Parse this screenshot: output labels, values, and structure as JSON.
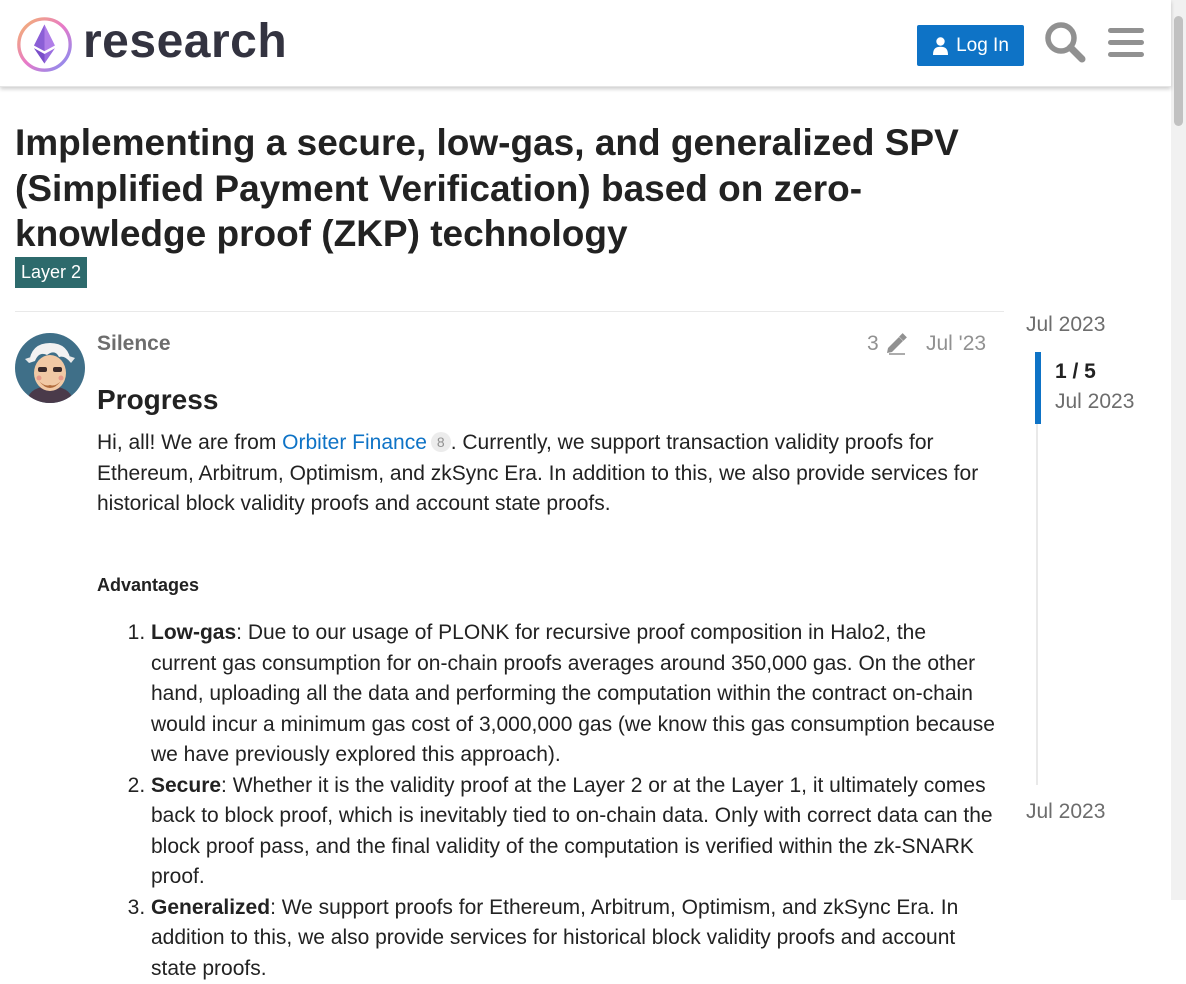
{
  "header": {
    "logo_text": "research",
    "login_label": "Log In",
    "search_icon": "search-icon",
    "menu_icon": "hamburger-menu-icon"
  },
  "topic": {
    "title": "Implementing a secure, low-gas, and generalized SPV (Simplified Payment Verification) based on zero-knowledge proof (ZKP) technology",
    "category": "Layer 2",
    "category_color": "#2d6a6c"
  },
  "post": {
    "username": "Silence",
    "edit_count": "3",
    "date": "Jul '23",
    "heading": "Progress",
    "intro_before": "Hi, all! We are from ",
    "intro_link": "Orbiter Finance",
    "intro_link_clicks": "8",
    "intro_after": ". Currently, we support transaction validity proofs for Ethereum, Arbitrum, Optimism, and zkSync Era. In addition to this, we also provide services for historical block validity proofs and account state proofs.",
    "advantages_heading": "Advantages",
    "advantages": [
      {
        "term": "Low-gas",
        "text": ": Due to our usage of PLONK for recursive proof composition in Halo2, the current gas consumption for on-chain proofs averages around 350,000 gas. On the other hand, uploading all the data and performing the computation within the contract on-chain would incur a minimum gas cost of 3,000,000 gas (we know this gas consumption because we have previously explored this approach)."
      },
      {
        "term": "Secure",
        "text": ": Whether it is the validity proof at the Layer 2 or at the Layer 1, it ultimately comes back to block proof, which is inevitably tied to on-chain data. Only with correct data can the block proof pass, and the final validity of the computation is verified within the zk-SNARK proof."
      },
      {
        "term": "Generalized",
        "text": ": We support proofs for Ethereum, Arbitrum, Optimism, and zkSync Era. In addition to this, we also provide services for historical block validity proofs and account state proofs."
      }
    ]
  },
  "timeline": {
    "start_label": "Jul 2023",
    "position": "1 / 5",
    "current_date": "Jul 2023",
    "end_label": "Jul 2023"
  },
  "colors": {
    "accent": "#0e73c6",
    "text": "#222222",
    "muted": "#919191"
  }
}
